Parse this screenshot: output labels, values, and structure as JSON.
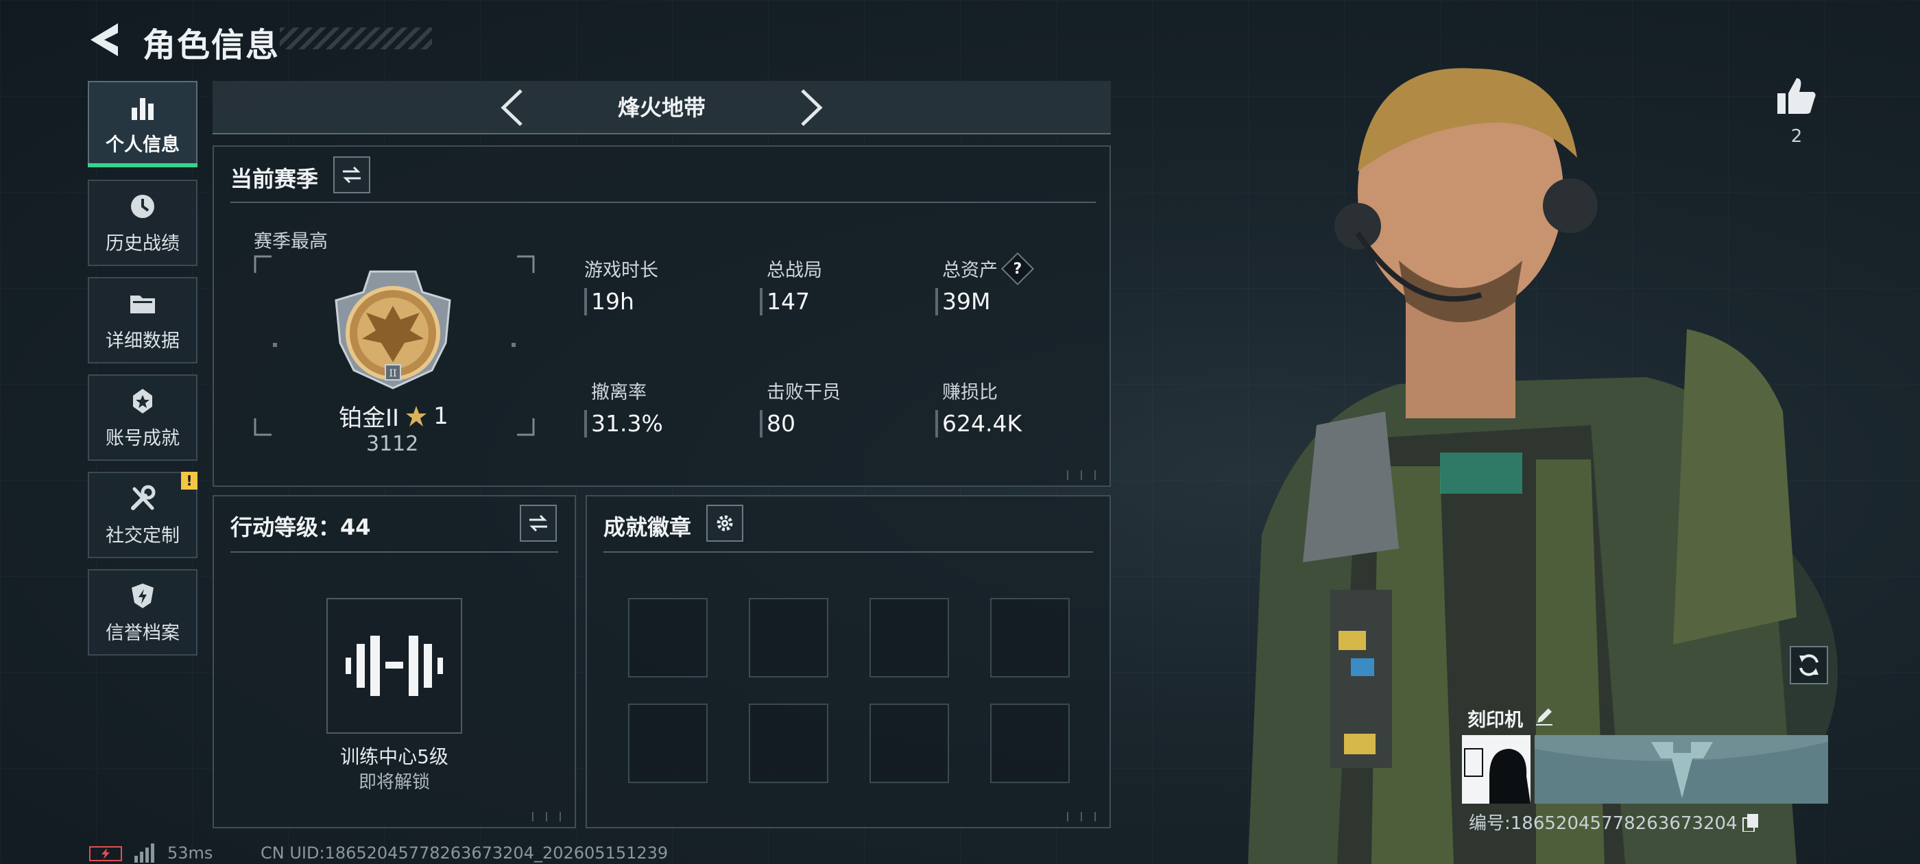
{
  "header": {
    "title": "角色信息"
  },
  "sidebar": {
    "items": [
      {
        "label": "个人信息",
        "icon": "bar-chart-icon",
        "active": true
      },
      {
        "label": "历史战绩",
        "icon": "clock-icon"
      },
      {
        "label": "详细数据",
        "icon": "folder-icon"
      },
      {
        "label": "账号成就",
        "icon": "achievement-star-icon"
      },
      {
        "label": "社交定制",
        "icon": "tools-icon",
        "badge": "!"
      },
      {
        "label": "信誉档案",
        "icon": "shield-icon"
      }
    ]
  },
  "mode": {
    "title": "烽火地带"
  },
  "season": {
    "title": "当前赛季",
    "best_label": "赛季最高",
    "rank_name": "铂金II",
    "rank_stars": "1",
    "rank_points": "3112",
    "stats": [
      {
        "label": "游戏时长",
        "value": "19h"
      },
      {
        "label": "总战局",
        "value": "147"
      },
      {
        "label": "总资产",
        "value": "39M",
        "help": "?"
      },
      {
        "label": "撤离率",
        "value": "31.3%"
      },
      {
        "label": "击败干员",
        "value": "80"
      },
      {
        "label": "赚损比",
        "value": "624.4K"
      }
    ]
  },
  "action_level": {
    "title": "行动等级：44",
    "item_title": "训练中心5级",
    "item_status": "即将解锁"
  },
  "achievements": {
    "title": "成就徽章",
    "slots": 8
  },
  "character": {
    "likes": "2",
    "imprint_label": "刻印机",
    "serial": "编号:18652045778263673204"
  },
  "footer": {
    "ping": "53ms",
    "uid": "CN UID:18652045778263673204_202605151239"
  },
  "colors": {
    "accent": "#35d58b",
    "warn": "#f2c744"
  }
}
